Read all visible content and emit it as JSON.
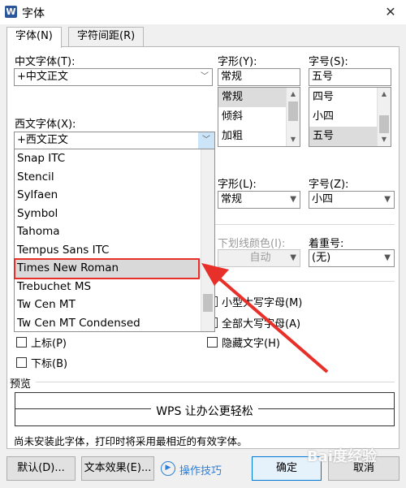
{
  "window": {
    "title": "字体",
    "close_glyph": "✕",
    "app_glyph": "W"
  },
  "tabs": [
    {
      "label": "字体(N)"
    },
    {
      "label": "字符间距(R)"
    }
  ],
  "chinese_font": {
    "label": "中文字体(T):",
    "value": "+中文正文"
  },
  "style_top": {
    "label": "字形(Y):",
    "value": "常规",
    "options": [
      "常规",
      "倾斜",
      "加粗"
    ],
    "selected": "常规"
  },
  "size_top": {
    "label": "字号(S):",
    "value": "五号",
    "options": [
      "四号",
      "小四",
      "五号"
    ],
    "selected": "五号"
  },
  "western_font": {
    "label": "西文字体(X):",
    "value": "+西文正文",
    "options": [
      "Snap ITC",
      "Stencil",
      "Sylfaen",
      "Symbol",
      "Tahoma",
      "Tempus Sans ITC",
      "Times New Roman",
      "Trebuchet MS",
      "Tw Cen MT",
      "Tw Cen MT Condensed"
    ],
    "highlighted": "Times New Roman"
  },
  "style_complex": {
    "label": "字形(L):",
    "value": "常规"
  },
  "size_complex": {
    "label": "字号(Z):",
    "value": "小四"
  },
  "underline_color": {
    "label": "下划线颜色(I):",
    "value": "自动"
  },
  "emphasis": {
    "label": "着重号:",
    "value": "(无)"
  },
  "effects": {
    "small_caps": "小型大写字母(M)",
    "all_caps": "全部大写字母(A)",
    "hidden": "隐藏文字(H)",
    "superscript": "上标(P)",
    "subscript": "下标(B)"
  },
  "preview": {
    "label": "预览",
    "sample": "WPS 让办公更轻松"
  },
  "notice": "尚未安装此字体，打印时将采用最相近的有效字体。",
  "buttons": {
    "default": "默认(D)...",
    "text_effect": "文本效果(E)...",
    "tips": "操作技巧",
    "ok": "确定",
    "cancel": "取消"
  },
  "colors": {
    "highlight": "#e8302a",
    "arrow": "#e8302a",
    "ok_border": "#0078d7",
    "tips_blue": "#2e7fd6"
  }
}
